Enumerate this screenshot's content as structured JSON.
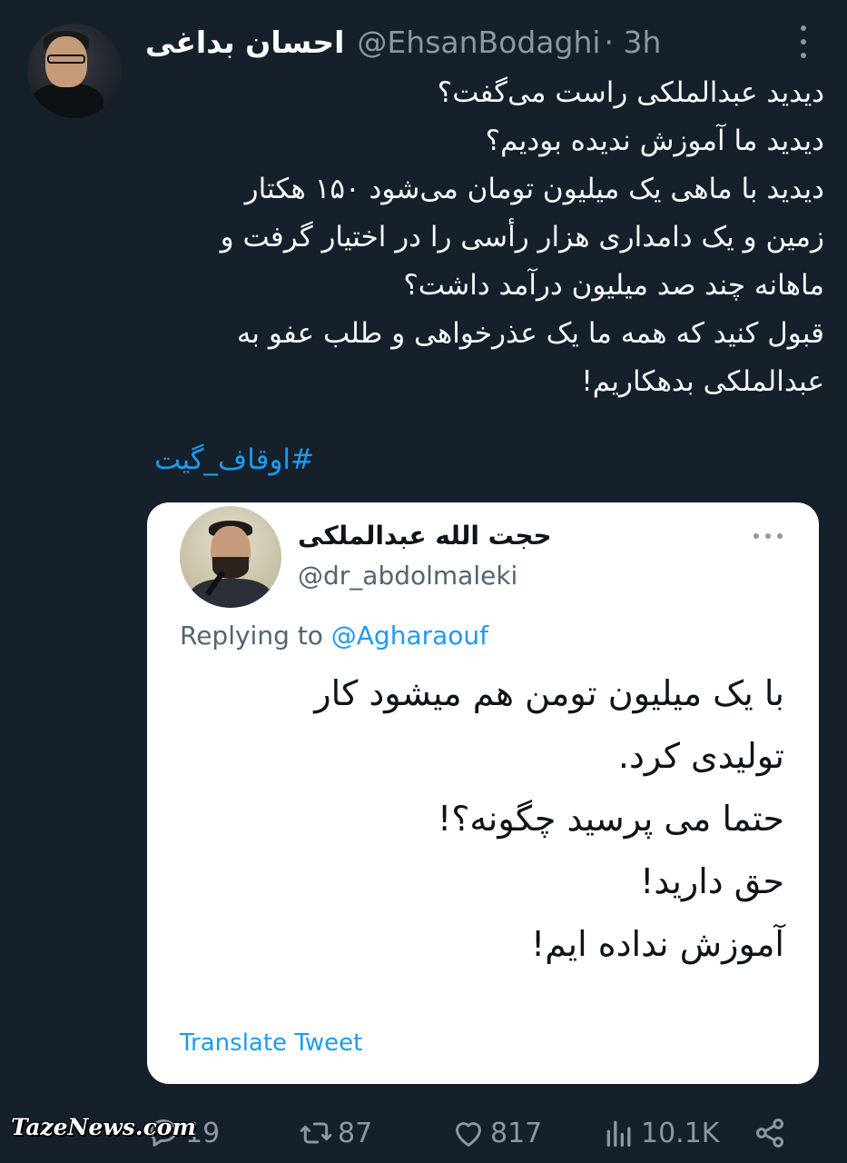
{
  "tweet": {
    "author_name": "احسان بداغی",
    "author_handle": "@EhsanBodaghi",
    "time": "· 3h",
    "lines": [
      "دیدید عبدالملکی راست می‌گفت؟",
      "دیدید ما آموزش ندیده بودیم؟",
      "دیدید با ماهی یک میلیون تومان می‌شود ۱۵۰ هکتار",
      "زمین و یک دامداری هزار رأسی را در اختیار گرفت و",
      "ماهانه چند صد میلیون درآمد داشت؟",
      "قبول کنید که همه ما یک عذرخواهی و طلب عفو به",
      "عبدالملکی بدهکاریم!"
    ],
    "hashtag": "#اوقاف_گیت"
  },
  "quoted": {
    "author_name": "حجت الله عبدالملکی",
    "author_handle": "@dr_abdolmaleki",
    "replying_prefix": "Replying to",
    "replying_to": "@Agharaouf",
    "lines": [
      "با یک میلیون تومن هم میشود کار",
      "تولیدی کرد.",
      "حتما می پرسید چگونه؟!",
      "حق دارید!",
      "آموزش نداده ایم!"
    ],
    "translate_label": "Translate Tweet"
  },
  "actions": {
    "replies": "19",
    "retweets": "87",
    "likes": "817",
    "views": "10.1K"
  },
  "watermark": "TazeNews.com",
  "colors": {
    "background": "#15202b",
    "accent": "#1d9bf0",
    "muted": "#8b98a5"
  },
  "icons": [
    "more-icon",
    "reply-icon",
    "retweet-icon",
    "like-icon",
    "views-icon",
    "share-icon"
  ]
}
